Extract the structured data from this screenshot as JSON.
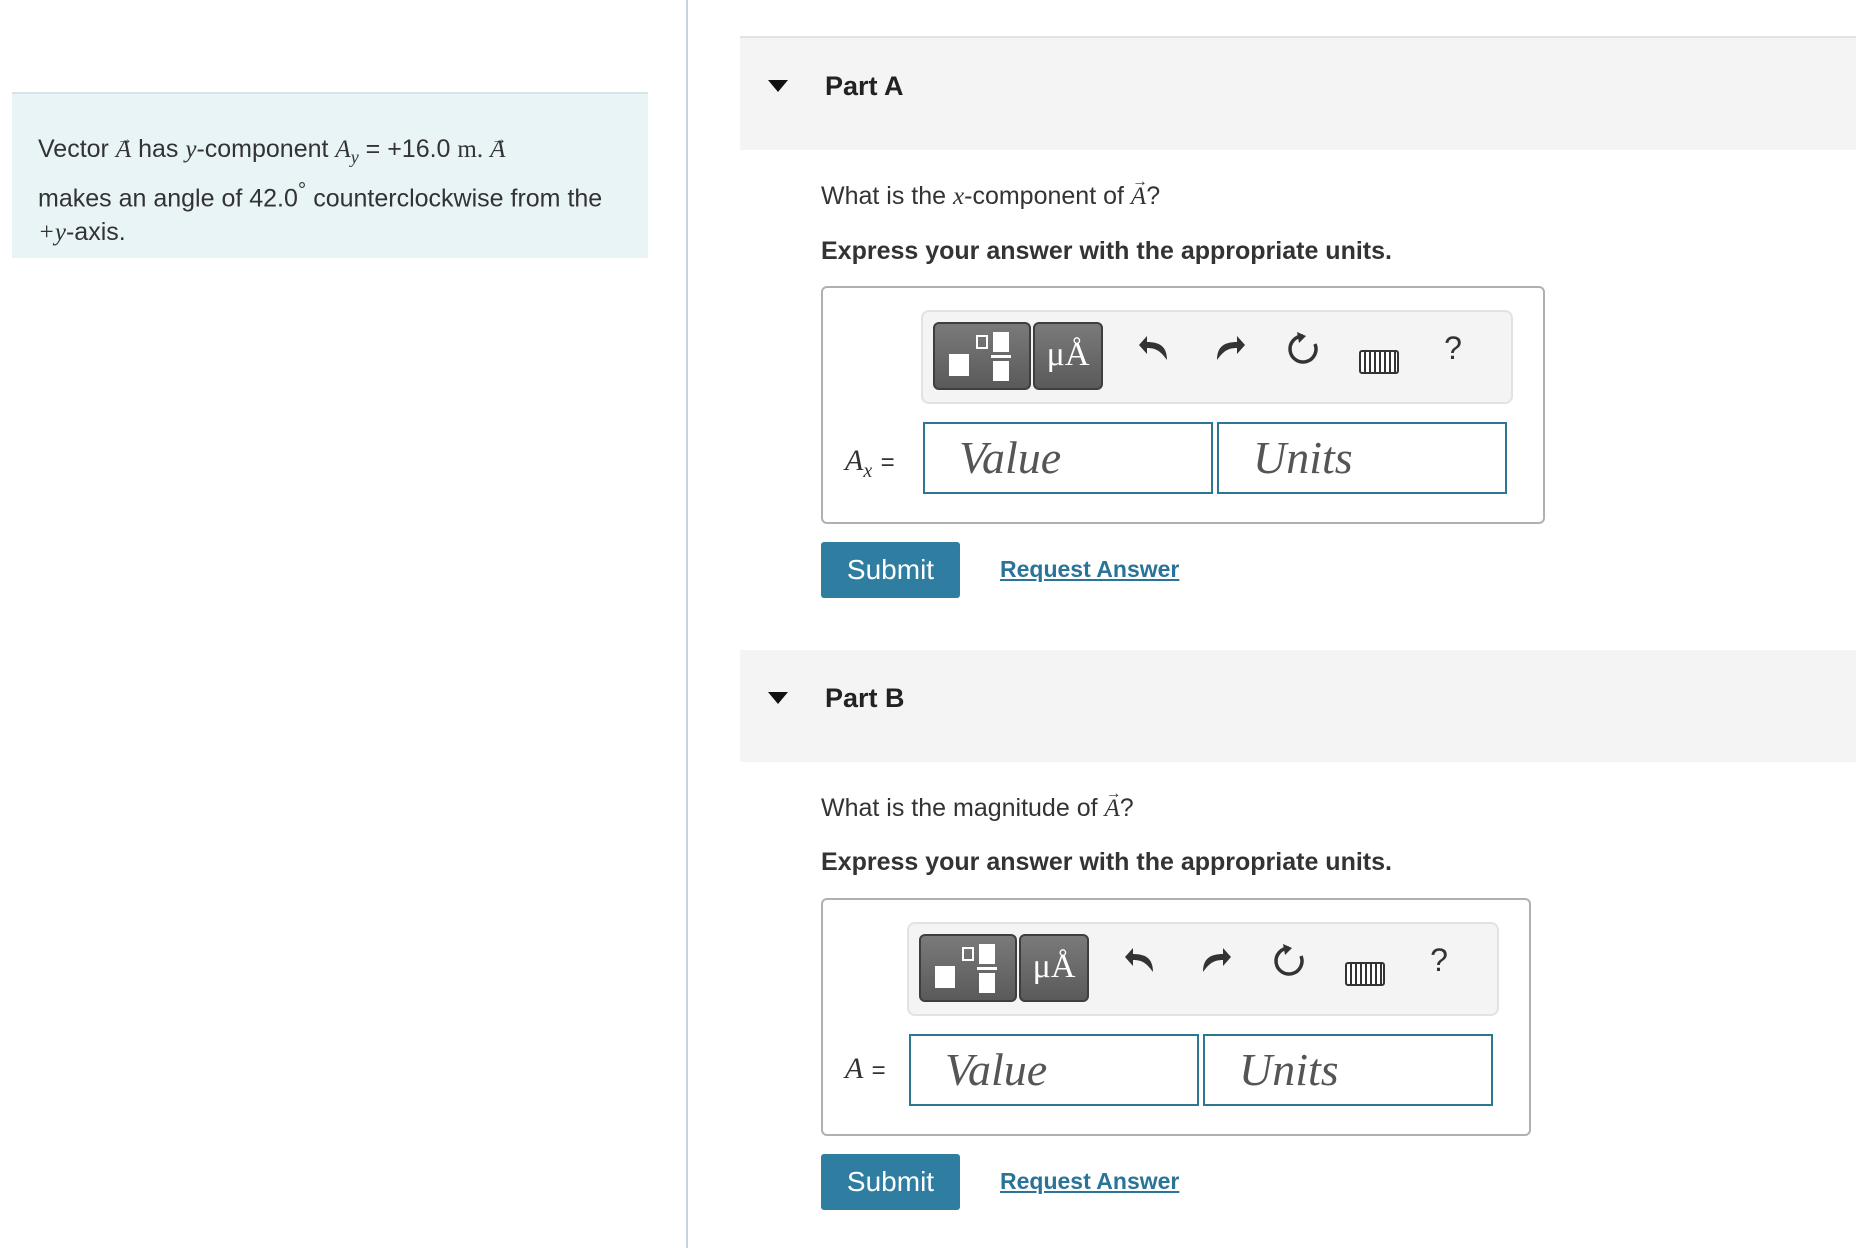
{
  "problem": {
    "word_vector": "Vector",
    "vec_symbol": "A",
    "text_has": "has",
    "y_var": "y",
    "text_component": "-component",
    "ay_sub": "y",
    "text_equals": "= +16.0",
    "unit_m": "m.",
    "text_makes": "makes an angle of 42.0",
    "degree": "°",
    "text_ccw": "counterclockwise from the",
    "plus_y": "+y",
    "text_axis": "-axis."
  },
  "parts": [
    {
      "title": "Part A",
      "question_prefix": "What is the",
      "question_var": "x",
      "question_middle": "-component of",
      "question_vec": "A",
      "question_suffix": "?",
      "instruction": "Express your answer with the appropriate units.",
      "lhs_symbol": "A",
      "lhs_sub": "x",
      "lhs_eq": "=",
      "value_placeholder": "Value",
      "units_placeholder": "Units",
      "submit_label": "Submit",
      "request_label": "Request Answer"
    },
    {
      "title": "Part B",
      "question_prefix": "What is the magnitude of",
      "question_vec": "A",
      "question_suffix": "?",
      "instruction": "Express your answer with the appropriate units.",
      "lhs_symbol": "A",
      "lhs_eq": "=",
      "value_placeholder": "Value",
      "units_placeholder": "Units",
      "submit_label": "Submit",
      "request_label": "Request Answer"
    }
  ],
  "toolbar": {
    "units_button_label": "μÅ",
    "help_label": "?",
    "icons": [
      "templates-icon",
      "units-icon",
      "undo-icon",
      "redo-icon",
      "reset-icon",
      "keyboard-icon",
      "help-icon"
    ]
  },
  "colors": {
    "accent": "#2f7ea1",
    "problem_bg": "#e8f4f6",
    "field_border": "#2b7794"
  }
}
